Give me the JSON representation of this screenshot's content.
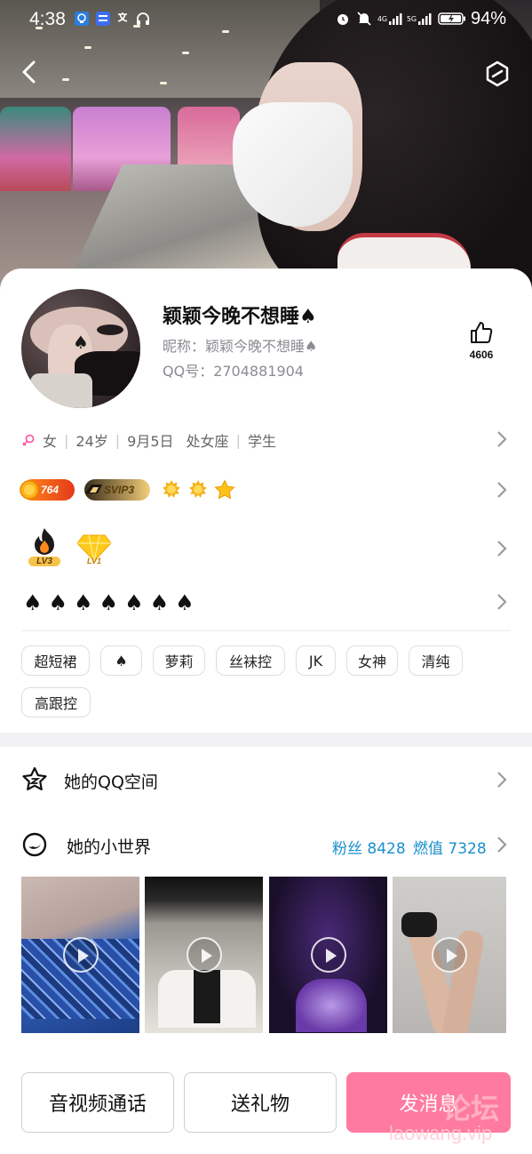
{
  "status_bar": {
    "time": "4:38",
    "net_4g": "4G",
    "net_5g": "5G",
    "battery": "94%"
  },
  "profile": {
    "display_name": "颖颖今晚不想睡♠",
    "nickname": "昵称：颖颖今晚不想睡♠",
    "qq_number": "QQ号：2704881904",
    "likes": "4606"
  },
  "info_row": {
    "gender_icon": "female-icon",
    "gender": "女",
    "age": "24岁",
    "birthday": "9月5日",
    "zodiac": "处女座",
    "occupation": "学生"
  },
  "badges": {
    "level_value": "764",
    "svip": "SVIP3",
    "lv_badge_1": "LV3",
    "lv_badge_2": "LV1"
  },
  "spades": [
    "♠",
    "♠",
    "♠",
    "♠",
    "♠",
    "♠",
    "♠"
  ],
  "tags": [
    "超短裙",
    "♠",
    "萝莉",
    "丝袜控",
    "JK",
    "女神",
    "清纯",
    "高跟控"
  ],
  "sections": {
    "qzone": "她的QQ空间",
    "world": "她的小世界",
    "fans": "粉丝 8428",
    "heat": "燃值 7328"
  },
  "actions": {
    "call": "音视频通话",
    "gift": "送礼物",
    "message": "发消息"
  },
  "watermark": {
    "line1": "论坛",
    "line2": "laowang.vip"
  },
  "colors": {
    "accent_blue": "#1a8fcf",
    "primary_pink": "#ff5f8f",
    "female_pink": "#ff5aa8"
  }
}
